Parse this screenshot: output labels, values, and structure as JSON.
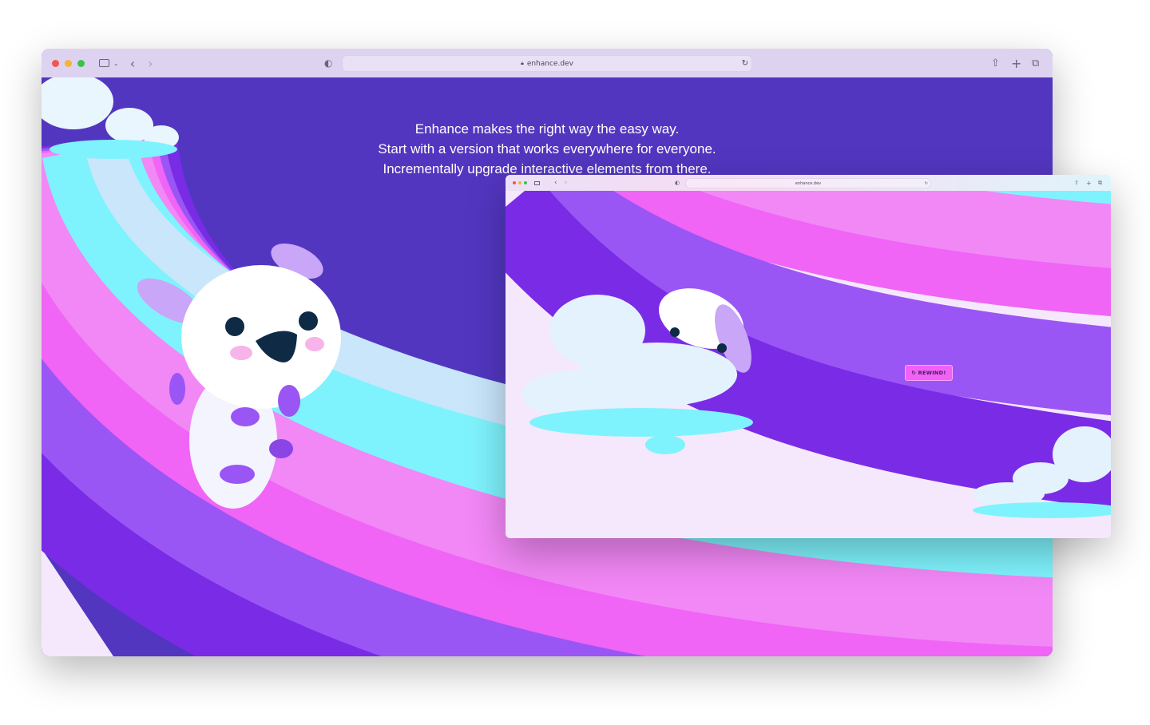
{
  "outer_browser": {
    "url": "enhance.dev",
    "icons": [
      "close-dot",
      "minimize-dot",
      "zoom-dot",
      "sidebar-icon",
      "chevron-down-icon",
      "back-icon",
      "forward-icon",
      "privacy-shield-icon",
      "lock-icon",
      "reload-icon",
      "share-icon",
      "new-tab-icon",
      "tabs-overview-icon"
    ],
    "tagline": [
      "Enhance makes the right way the easy way.",
      "Start with a version that works everywhere for everyone.",
      "Incrementally upgrade interactive elements from there."
    ]
  },
  "inner_browser": {
    "url": "enhance.dev",
    "rewind_button": "↻ REWIND!"
  },
  "colors": {
    "page_bg": "#5236c0",
    "dark_purple": "#7a2be6",
    "purple": "#9a55f5",
    "magenta": "#f064f6",
    "pink": "#f287f6",
    "cyan": "#7ff3fd",
    "light_blue": "#c9e6fb",
    "lavender": "#f5e8fc"
  }
}
